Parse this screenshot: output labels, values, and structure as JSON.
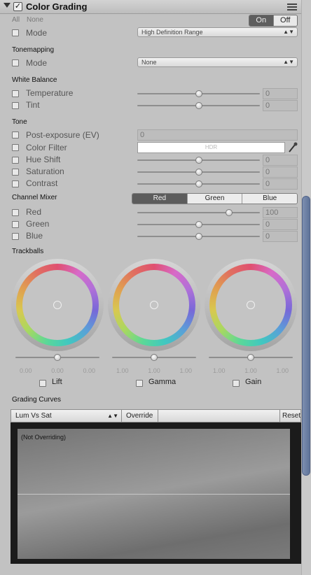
{
  "header": {
    "title": "Color Grading",
    "enabled_mark": "✓",
    "all": "All",
    "none": "None",
    "toggle_on": "On",
    "toggle_off": "Off"
  },
  "general": {
    "mode_label": "Mode",
    "mode_value": "High Definition Range"
  },
  "tonemapping": {
    "title": "Tonemapping",
    "mode_label": "Mode",
    "mode_value": "None"
  },
  "white_balance": {
    "title": "White Balance",
    "params": [
      {
        "label": "Temperature",
        "value": "0",
        "slider": 0.5
      },
      {
        "label": "Tint",
        "value": "0",
        "slider": 0.5
      }
    ]
  },
  "tone": {
    "title": "Tone",
    "post_exposure": {
      "label": "Post-exposure (EV)",
      "value": "0"
    },
    "color_filter": {
      "label": "Color Filter",
      "hdr_text": "HDR"
    },
    "params": [
      {
        "label": "Hue Shift",
        "value": "0",
        "slider": 0.5
      },
      {
        "label": "Saturation",
        "value": "0",
        "slider": 0.5
      },
      {
        "label": "Contrast",
        "value": "0",
        "slider": 0.5
      }
    ]
  },
  "channel_mixer": {
    "title": "Channel Mixer",
    "tabs": [
      "Red",
      "Green",
      "Blue"
    ],
    "params": [
      {
        "label": "Red",
        "value": "100",
        "slider": 0.75
      },
      {
        "label": "Green",
        "value": "0",
        "slider": 0.5
      },
      {
        "label": "Blue",
        "value": "0",
        "slider": 0.5
      }
    ]
  },
  "trackballs": {
    "title": "Trackballs",
    "wheels": [
      {
        "name": "Lift",
        "values": [
          "0.00",
          "0.00",
          "0.00"
        ],
        "slider": 0.5
      },
      {
        "name": "Gamma",
        "values": [
          "1.00",
          "1.00",
          "1.00"
        ],
        "slider": 0.5
      },
      {
        "name": "Gain",
        "values": [
          "1.00",
          "1.00",
          "1.00"
        ],
        "slider": 0.5
      }
    ]
  },
  "grading_curves": {
    "title": "Grading Curves",
    "curve_select": "Lum Vs Sat",
    "override_label": "Override",
    "reset_label": "Reset",
    "status": "(Not Overriding)"
  }
}
